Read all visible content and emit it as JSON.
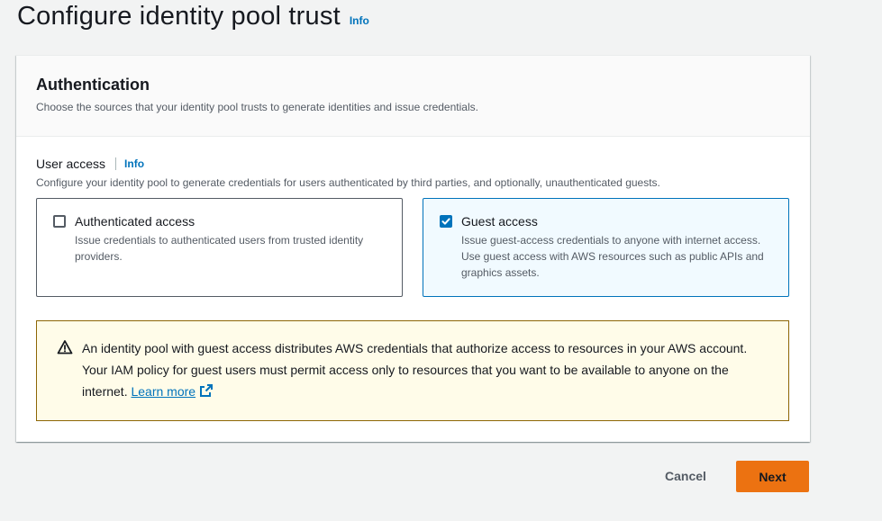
{
  "page": {
    "title": "Configure identity pool trust",
    "info_label": "Info"
  },
  "authentication": {
    "heading": "Authentication",
    "description": "Choose the sources that your identity pool trusts to generate identities and issue credentials."
  },
  "user_access": {
    "label": "User access",
    "info_label": "Info",
    "description": "Configure your identity pool to generate credentials for users authenticated by third parties, and optionally, unauthenticated guests.",
    "options": [
      {
        "title": "Authenticated access",
        "description": "Issue credentials to authenticated users from trusted identity providers.",
        "checked": false
      },
      {
        "title": "Guest access",
        "description": "Issue guest-access credentials to anyone with internet access. Use guest access with AWS resources such as public APIs and graphics assets.",
        "checked": true
      }
    ]
  },
  "alert": {
    "type": "warning",
    "icon": "warning-triangle-icon",
    "text": "An identity pool with guest access distributes AWS credentials that authorize access to resources in your AWS account. Your IAM policy for guest users must permit access only to resources that you want to be available to anyone on the internet. ",
    "link_label": "Learn more",
    "link_icon": "external-link-icon"
  },
  "actions": {
    "cancel_label": "Cancel",
    "next_label": "Next"
  },
  "colors": {
    "link": "#0073bb",
    "primary_button": "#ec7211",
    "warning_border": "#8d6605",
    "warning_bg": "#fffce9",
    "selected_tile_bg": "#f1faff"
  }
}
